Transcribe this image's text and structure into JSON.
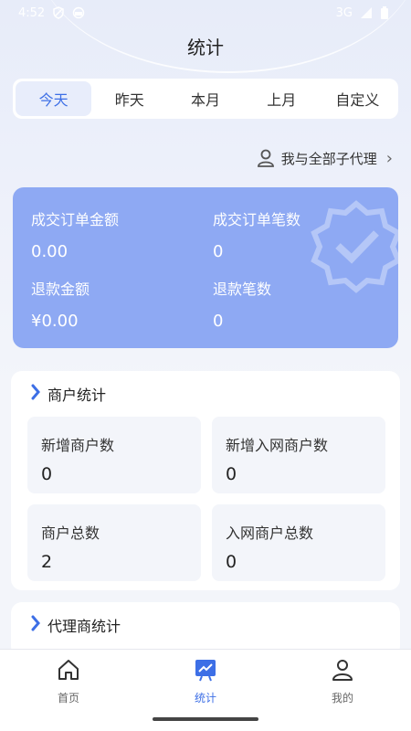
{
  "status_bar": {
    "time": "4:52",
    "network": "3G",
    "icons": [
      "shield-icon",
      "face-icon",
      "signal-icon",
      "battery-icon"
    ]
  },
  "header": {
    "title": "统计"
  },
  "tabs": [
    {
      "label": "今天",
      "active": true
    },
    {
      "label": "昨天",
      "active": false
    },
    {
      "label": "本月",
      "active": false
    },
    {
      "label": "上月",
      "active": false
    },
    {
      "label": "自定义",
      "active": false
    }
  ],
  "agent_filter": {
    "label": "我与全部子代理",
    "icon": "user-icon",
    "chevron": "›"
  },
  "summary": {
    "order_amount_label": "成交订单金额",
    "order_amount_value": "0.00",
    "order_count_label": "成交订单笔数",
    "order_count_value": "0",
    "refund_amount_label": "退款金额",
    "refund_amount_value": "¥0.00",
    "refund_count_label": "退款笔数",
    "refund_count_value": "0",
    "card_color": "#8ea9f3"
  },
  "merchant_stats": {
    "title": "商户统计",
    "items": [
      {
        "label": "新增商户数",
        "value": "0"
      },
      {
        "label": "新增入网商户数",
        "value": "0"
      },
      {
        "label": "商户总数",
        "value": "2"
      },
      {
        "label": "入网商户总数",
        "value": "0"
      }
    ]
  },
  "agent_stats": {
    "title": "代理商统计"
  },
  "bottom_nav": [
    {
      "label": "首页",
      "icon": "home-icon",
      "active": false
    },
    {
      "label": "统计",
      "icon": "chart-icon",
      "active": true
    },
    {
      "label": "我的",
      "icon": "user-icon",
      "active": false
    }
  ],
  "colors": {
    "accent": "#3d6fe6",
    "background": "#f3f5fa"
  }
}
